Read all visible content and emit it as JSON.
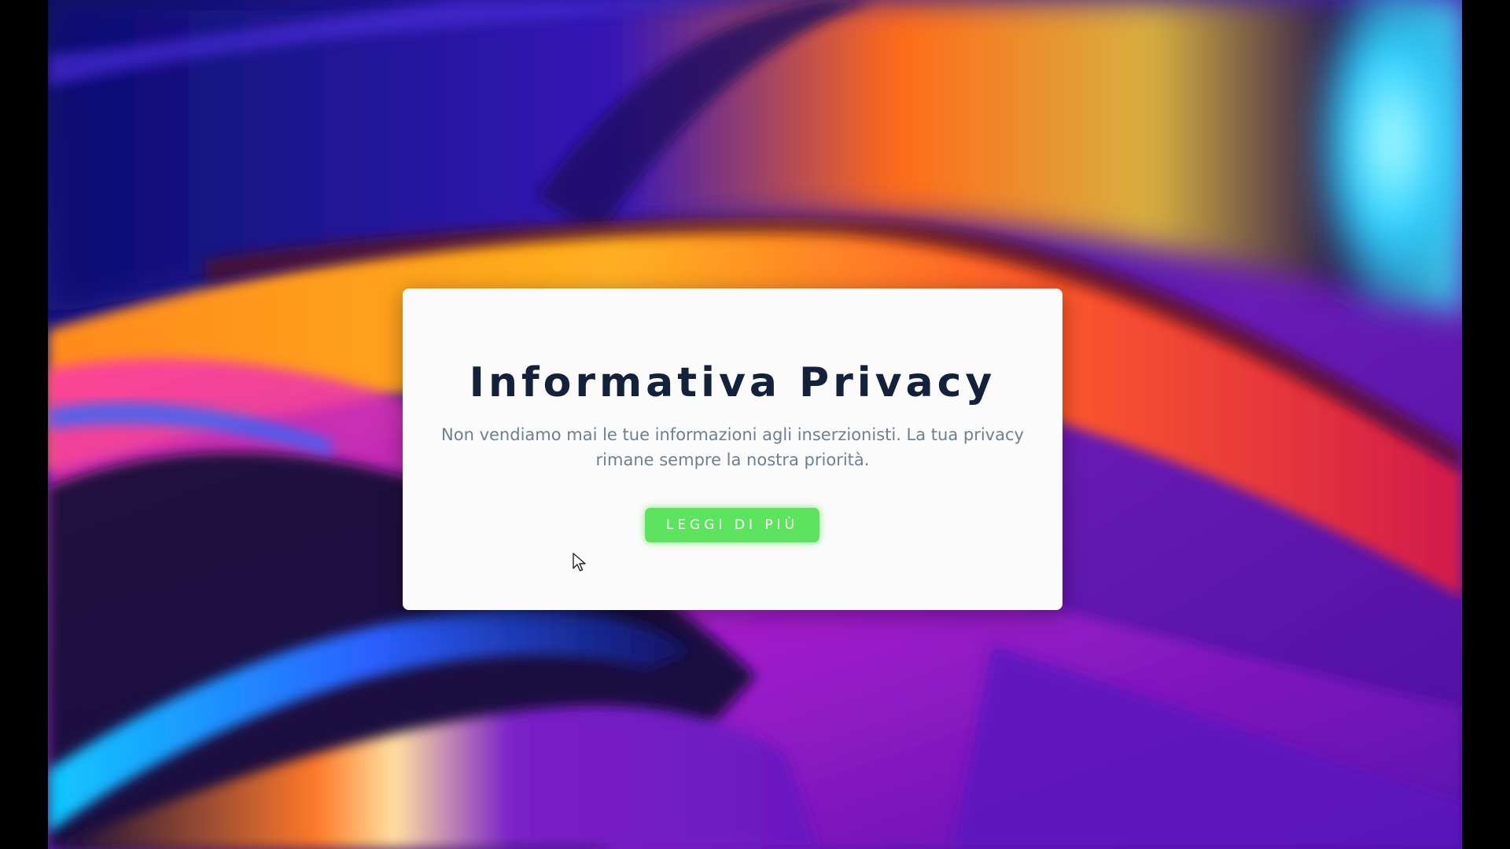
{
  "dialog": {
    "title": "Informativa Privacy",
    "message": "Non vendiamo mai le tue informazioni agli inserzionisti. La tua privacy rimane sempre la nostra priorità.",
    "button_label": "LEGGI DI PIÙ"
  },
  "colors": {
    "card_background": "#fbfbfb",
    "title_color": "#14213a",
    "message_color": "#6f7f8e",
    "button_color": "#5ee35e",
    "button_text_color": "#ffffff"
  },
  "icons": {
    "cursor": "mouse-pointer-icon"
  }
}
